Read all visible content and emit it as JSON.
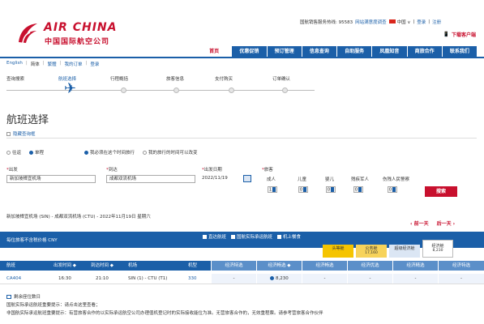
{
  "brand": {
    "logo_en": "AIR CHINA",
    "logo_cn": "中国国际航空公司"
  },
  "top_links": {
    "hotline": "国航销售服务热线: 95583",
    "survey": "网站满意度调查",
    "lang": "中国 ∨",
    "login": "登录",
    "register": "注册"
  },
  "download": "下载客户端",
  "nav": [
    "首页",
    "优惠促销",
    "预订管理",
    "信息查询",
    "自助服务",
    "凤凰知音",
    "商旅合作",
    "联系我们"
  ],
  "lang_bar": [
    "English",
    "简体",
    "繁體",
    "我的订单",
    "登录"
  ],
  "steps": [
    "查询搜索",
    "航班选择",
    "行程概括",
    "旅客信息",
    "支付购买",
    "订单确认"
  ],
  "page_title": "航班选择",
  "hide_search": "隐藏查询框",
  "trip": {
    "round": "往返",
    "oneway": "单程",
    "opt_fixed": "我必须在这个时间旅行",
    "opt_flex": "我的旅行的时间可以改变"
  },
  "form": {
    "origin_label": "出发",
    "origin_value": "新加坡樟宜机场",
    "dest_label": "到达",
    "dest_value": "成都双流机场",
    "date_label": "出发日期",
    "date_value": "2022/11/19",
    "pax_label": "旅客",
    "pax_types": [
      {
        "label": "成人",
        "value": "1"
      },
      {
        "label": "儿童",
        "value": "0"
      },
      {
        "label": "婴儿",
        "value": "0"
      },
      {
        "label": "残疾军人",
        "value": "0"
      },
      {
        "label": "伤残人民警察",
        "value": "0"
      }
    ],
    "search_btn": "搜索"
  },
  "route_line": "新加坡樟宜机场 (SIN) - 成都双流机场 (CTU) - 2022年11月19日 星期六",
  "day_nav": {
    "prev": "前一天",
    "next": "后一天"
  },
  "bar": {
    "left_text": "每位旅客不含税价格 CNY",
    "filters": [
      "直达航班",
      "国航实际承运航班",
      "机上餐食"
    ]
  },
  "cabins": [
    {
      "name": "头等舱",
      "price": "",
      "color": "#f5c400"
    },
    {
      "name": "公务舱",
      "price": "17,160",
      "color": "#f7d35a"
    },
    {
      "name": "超级经济舱",
      "price": "",
      "color": "#dbe6f4"
    },
    {
      "name": "经济舱",
      "price": "8,230",
      "color": "#e8eef7"
    }
  ],
  "columns": [
    "航班",
    "出发时间 ◆",
    "到达时间 ◆",
    "机场",
    "机型",
    "经济特选",
    "经济畅选 ◆",
    "经济畅选",
    "经济优选",
    "经济精选",
    "经济特选"
  ],
  "flight": {
    "no": "CA404",
    "dep": "16:30",
    "arr": "21:10",
    "airport": "SIN (1) - CTU (T1)",
    "type": "330",
    "fares": [
      "-",
      "8,230",
      "-",
      "-",
      "-",
      "-"
    ]
  },
  "remaining": "剩余座位数日",
  "note1": "国航实际承运航班重要提示：请点击这里查看；",
  "note2": "非国航实际承运航班重要提示：有营旅客合作的以实际承运航空公司办理值机登记时的实际接收能位为准。无营旅客合作的，无效重程票。请参考营旅客合作伙伴"
}
